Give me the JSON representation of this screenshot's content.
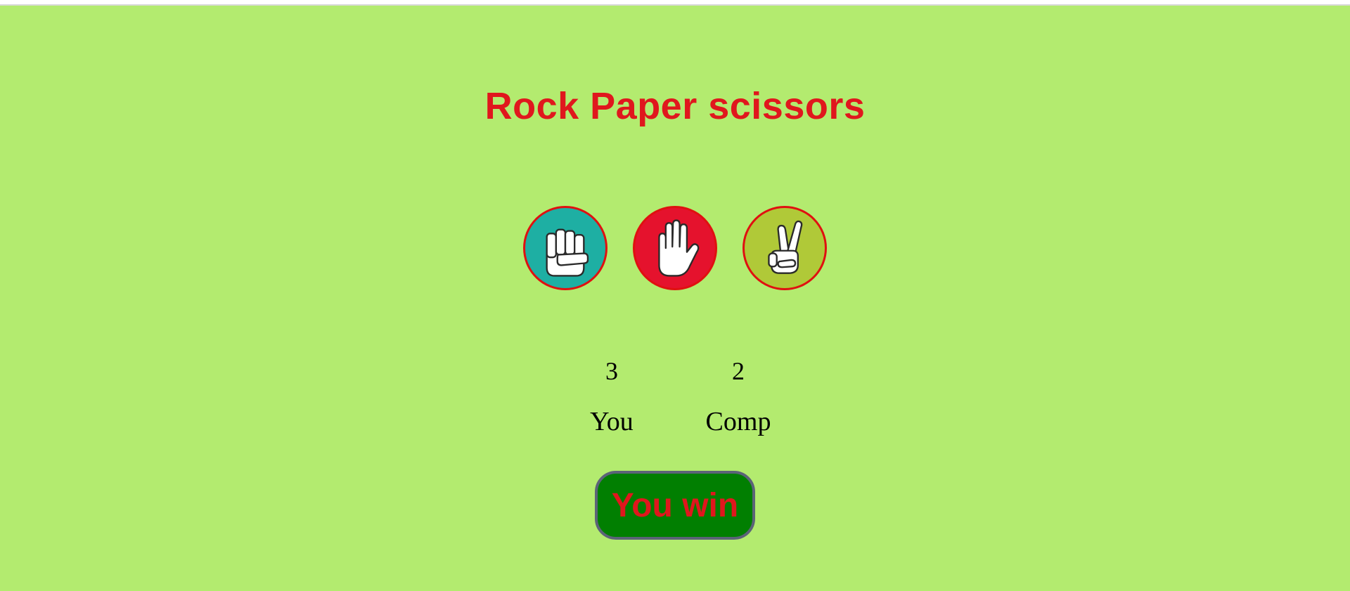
{
  "title": "Rock Paper scissors",
  "choices": [
    {
      "name": "rock",
      "icon": "rock-fist-icon",
      "color": "#1eafa3"
    },
    {
      "name": "paper",
      "icon": "paper-hand-icon",
      "color": "#e5122d"
    },
    {
      "name": "scissors",
      "icon": "scissors-hand-icon",
      "color": "#b0c938"
    }
  ],
  "scores": {
    "user": {
      "value": "3",
      "label": "You"
    },
    "comp": {
      "value": "2",
      "label": "Comp"
    }
  },
  "result": {
    "message": "You win",
    "background": "#017f01",
    "text_color": "#e0171d"
  },
  "colors": {
    "page_background": "#b3eb6f",
    "title": "#e0171d",
    "choice_border": "#e01010"
  }
}
